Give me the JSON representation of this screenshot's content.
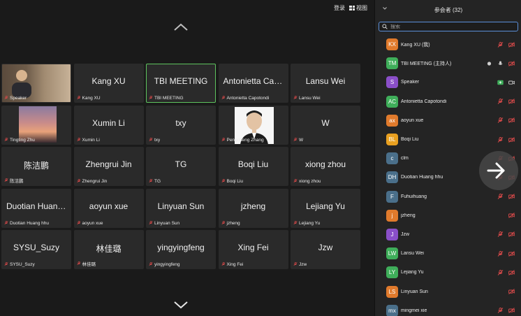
{
  "topbar": {
    "login_label": "登录",
    "view_label": "视图"
  },
  "gallery": {
    "tiles": [
      {
        "center": "",
        "foot": "Speaker",
        "kind": "speaker"
      },
      {
        "center": "Kang XU",
        "foot": "Kang XU"
      },
      {
        "center": "TBI MEETING",
        "foot": "TBI MEETING",
        "kind": "active"
      },
      {
        "center": "Antonietta Cap...",
        "foot": "Antonietta Capotondi"
      },
      {
        "center": "Lansu Wei",
        "foot": "Lansu Wei"
      },
      {
        "center": "",
        "foot": "Tingting Zhu",
        "kind": "sunset"
      },
      {
        "center": "Xumin Li",
        "foot": "Xumin Li"
      },
      {
        "center": "txy",
        "foot": "txy"
      },
      {
        "center": "",
        "foot": "Pengcheng Zhang",
        "kind": "portrait"
      },
      {
        "center": "W",
        "foot": "W"
      },
      {
        "center": "陈洁鹏",
        "foot": "陈洁鹏"
      },
      {
        "center": "Zhengrui Jin",
        "foot": "Zhengrui Jin"
      },
      {
        "center": "TG",
        "foot": "TG"
      },
      {
        "center": "Boqi Liu",
        "foot": "Boqi Liu"
      },
      {
        "center": "xiong zhou",
        "foot": "xiong zhou"
      },
      {
        "center": "Duotian Huang...",
        "foot": "Duotian Huang hhu"
      },
      {
        "center": "aoyun xue",
        "foot": "aoyun xue"
      },
      {
        "center": "Linyuan Sun",
        "foot": "Linyuan Sun"
      },
      {
        "center": "jzheng",
        "foot": "jzheng"
      },
      {
        "center": "Lejiang Yu",
        "foot": "Lejiang Yu"
      },
      {
        "center": "SYSU_Suzy",
        "foot": "SYSU_Suzy"
      },
      {
        "center": "林佳璐",
        "foot": "林佳璐"
      },
      {
        "center": "yingyingfeng",
        "foot": "yingyingfeng"
      },
      {
        "center": "Xing Fei",
        "foot": "Xing Fei"
      },
      {
        "center": "Jzw",
        "foot": "Jzw"
      }
    ]
  },
  "panel": {
    "title": "参会者 (32)",
    "search_placeholder": "搜索",
    "participants": [
      {
        "initials": "KX",
        "name": "Kang XU (我)",
        "color": "#e07a2c",
        "icons": [
          "mic-off",
          "video-off"
        ]
      },
      {
        "initials": "TM",
        "name": "TBI MEETING (主持人)",
        "color": "#3fae5a",
        "icons": [
          "dot",
          "mic-on",
          "video-off"
        ]
      },
      {
        "initials": "S",
        "name": "Speaker",
        "color": "#8a4fc8",
        "icons": [
          "share",
          "video-on"
        ]
      },
      {
        "initials": "AC",
        "name": "Antonietta Capotondi",
        "color": "#3fae5a",
        "icons": [
          "mic-off",
          "video-off"
        ]
      },
      {
        "initials": "ax",
        "name": "aoyun xue",
        "color": "#e07a2c",
        "icons": [
          "mic-off",
          "video-off"
        ]
      },
      {
        "initials": "BL",
        "name": "Boqi Liu",
        "color": "#e8a020",
        "icons": [
          "mic-off",
          "video-off"
        ]
      },
      {
        "initials": "c",
        "name": "clm",
        "color": "#4a6f8a",
        "icons": [
          "mic-off",
          "video-off"
        ]
      },
      {
        "initials": "DH",
        "name": "Duotian Huang hhu",
        "color": "#4a6f8a",
        "icons": [
          "mic-off",
          "video-off"
        ]
      },
      {
        "initials": "F",
        "name": "Fuhuihuang",
        "color": "#4a6f8a",
        "icons": [
          "mic-off",
          "video-off"
        ]
      },
      {
        "initials": "j",
        "name": "jzheng",
        "color": "#e07a2c",
        "icons": [
          "video-off"
        ]
      },
      {
        "initials": "J",
        "name": "Jzw",
        "color": "#8a4fc8",
        "icons": [
          "mic-off",
          "video-off"
        ]
      },
      {
        "initials": "LW",
        "name": "Lansu Wei",
        "color": "#3fae5a",
        "icons": [
          "mic-off",
          "video-off"
        ]
      },
      {
        "initials": "LY",
        "name": "Lejiang Yu",
        "color": "#3fae5a",
        "icons": [
          "mic-off",
          "video-off"
        ]
      },
      {
        "initials": "LS",
        "name": "Linyuan Sun",
        "color": "#e07a2c",
        "icons": [
          "video-off"
        ]
      },
      {
        "initials": "mx",
        "name": "mingmei xie",
        "color": "#4a6f8a",
        "icons": [
          "mic-off",
          "video-off"
        ]
      }
    ]
  }
}
